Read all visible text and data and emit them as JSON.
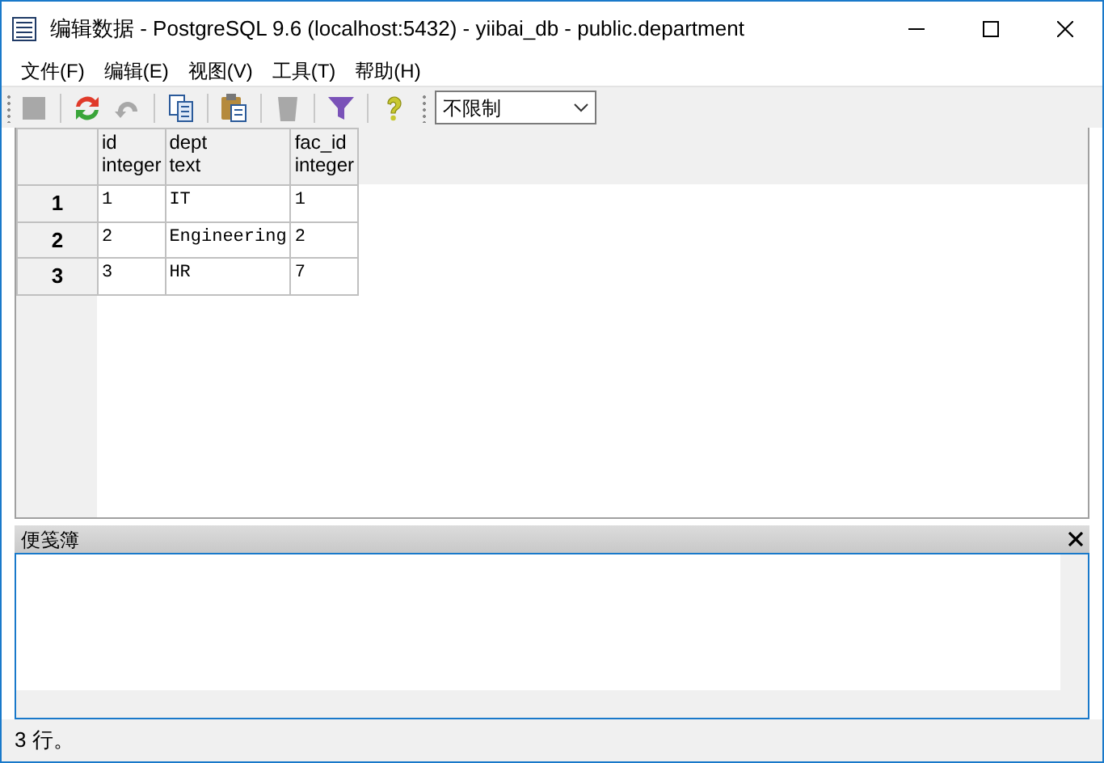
{
  "window": {
    "title": "编辑数据 - PostgreSQL 9.6 (localhost:5432) - yiibai_db - public.department"
  },
  "menu": [
    "文件(F)",
    "编辑(E)",
    "视图(V)",
    "工具(T)",
    "帮助(H)"
  ],
  "toolbar": [
    {
      "kind": "stop",
      "disabled": true
    },
    {
      "kind": "separator"
    },
    {
      "kind": "refresh",
      "disabled": false
    },
    {
      "kind": "undo",
      "disabled": true
    },
    {
      "kind": "separator"
    },
    {
      "kind": "copy",
      "disabled": false
    },
    {
      "kind": "separator"
    },
    {
      "kind": "paste",
      "disabled": false
    },
    {
      "kind": "separator"
    },
    {
      "kind": "delete",
      "disabled": true
    },
    {
      "kind": "separator"
    },
    {
      "kind": "filter",
      "disabled": false
    },
    {
      "kind": "separator"
    },
    {
      "kind": "help",
      "disabled": false
    }
  ],
  "limit_dropdown": {
    "value": "不限制"
  },
  "table": {
    "columns": [
      {
        "name": "id",
        "type": "integer"
      },
      {
        "name": "dept",
        "type": "text"
      },
      {
        "name": "fac_id",
        "type": "integer"
      }
    ],
    "rows": [
      {
        "row_number": "1",
        "cells": [
          "1",
          "IT",
          "1"
        ]
      },
      {
        "row_number": "2",
        "cells": [
          "2",
          "Engineering",
          "2"
        ]
      },
      {
        "row_number": "3",
        "cells": [
          "3",
          "HR",
          "7"
        ]
      }
    ]
  },
  "scratch_pad": {
    "title": "便笺簿"
  },
  "status_bar": "3 行。"
}
